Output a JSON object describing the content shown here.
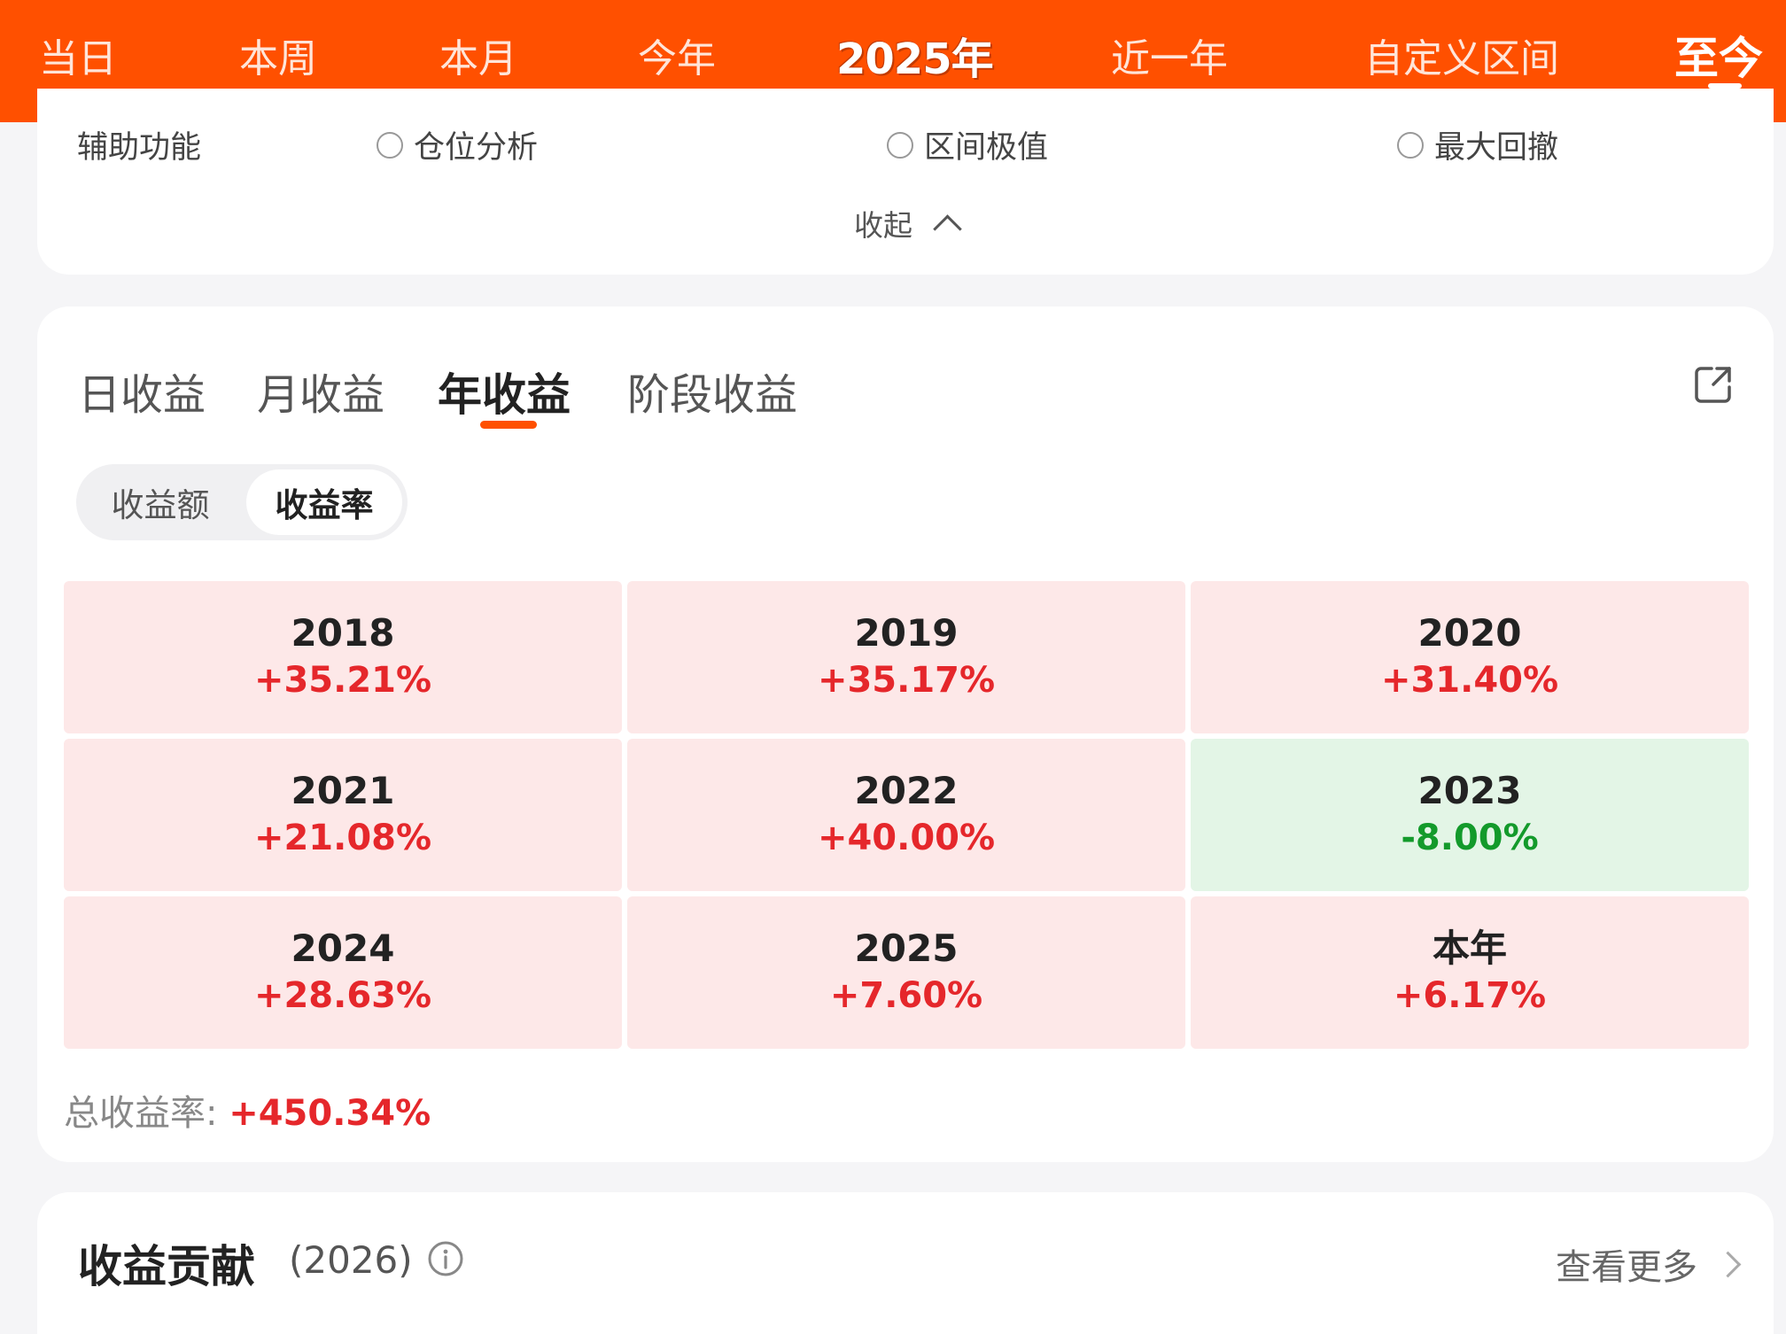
{
  "top_tabs": [
    "当日",
    "本周",
    "本月",
    "今年",
    "2025年",
    "近一年",
    "自定义区间",
    "至今"
  ],
  "options": {
    "aux_label": "辅助功能",
    "items": [
      "仓位分析",
      "区间极值",
      "最大回撤"
    ],
    "collapse_label": "收起"
  },
  "returns": {
    "tabs": [
      "日收益",
      "月收益",
      "年收益",
      "阶段收益"
    ],
    "active_tab": "年收益",
    "segment": {
      "amount_label": "收益额",
      "rate_label": "收益率",
      "selected": "收益率"
    },
    "cells": [
      {
        "year": "2018",
        "value": "+35.21%"
      },
      {
        "year": "2019",
        "value": "+35.17%"
      },
      {
        "year": "2020",
        "value": "+31.40%"
      },
      {
        "year": "2021",
        "value": "+21.08%"
      },
      {
        "year": "2022",
        "value": "+40.00%"
      },
      {
        "year": "2023",
        "value": "-8.00%"
      },
      {
        "year": "2024",
        "value": "+28.63%"
      },
      {
        "year": "2025",
        "value": "+7.60%"
      },
      {
        "year": "本年",
        "value": "+6.17%"
      }
    ],
    "total_label": "总收益率:",
    "total_value": "+450.34%"
  },
  "contribution": {
    "title": "收益贡献",
    "year": "(2026)",
    "see_more": "查看更多"
  },
  "colors": {
    "accent": "#ff5000",
    "gain_text": "#e5272b",
    "gain_bg": "#fde8e8",
    "loss_text": "#139a2b",
    "loss_bg": "#e3f5e6"
  },
  "icons": [
    "radio-icon",
    "chevron-up-icon",
    "share-icon",
    "info-icon",
    "chevron-right-icon"
  ]
}
